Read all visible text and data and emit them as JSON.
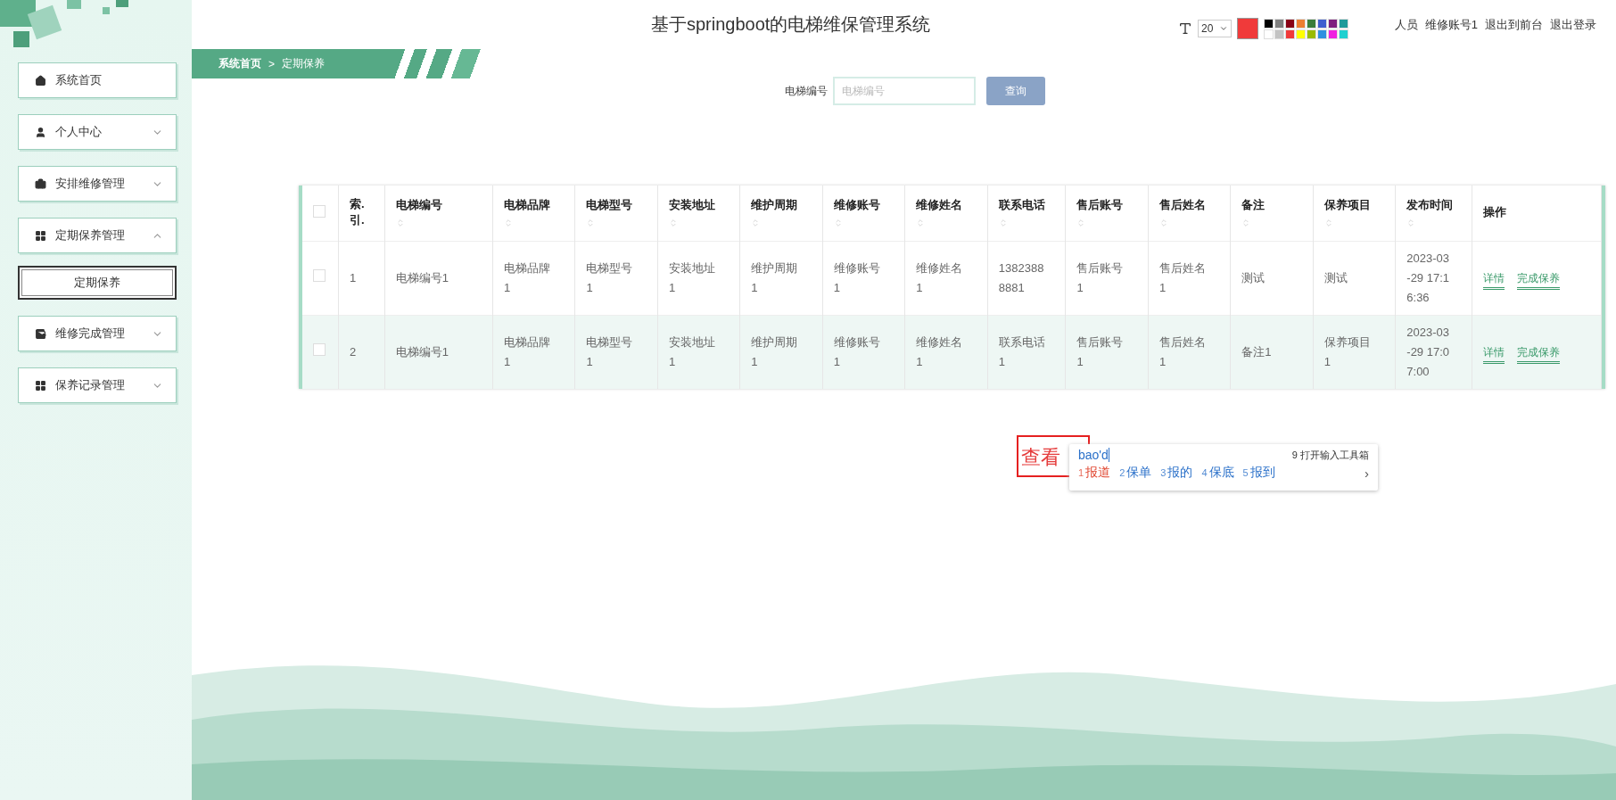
{
  "sidebar": {
    "items": [
      {
        "label": "系统首页",
        "kind": "link"
      },
      {
        "label": "个人中心",
        "kind": "menu",
        "expanded": false
      },
      {
        "label": "安排维修管理",
        "kind": "menu",
        "expanded": false
      },
      {
        "label": "定期保养管理",
        "kind": "menu",
        "expanded": true,
        "children": [
          {
            "label": "定期保养",
            "selected": true
          }
        ]
      },
      {
        "label": "维修完成管理",
        "kind": "menu",
        "expanded": false
      },
      {
        "label": "保养记录管理",
        "kind": "menu",
        "expanded": false
      }
    ]
  },
  "header": {
    "title": "基于springboot的电梯维保管理系统",
    "user_links": [
      "人员",
      "维修账号1",
      "退出到前台",
      "退出登录"
    ]
  },
  "annotation_toolbar": {
    "font_size": "20",
    "current": {
      "color": "#f03a3a"
    },
    "palette": [
      {
        "color": "#000000"
      },
      {
        "color": "#7f7f7f"
      },
      {
        "color": "#880015"
      },
      {
        "color": "#ed7d31"
      },
      {
        "color": "#3b7d3b"
      },
      {
        "color": "#3f5fcf"
      },
      {
        "color": "#7f1f7f"
      },
      {
        "color": "#1f9a9a"
      },
      {
        "color": "#ffffff"
      },
      {
        "color": "#c3c3c3"
      },
      {
        "color": "#f03a3a"
      },
      {
        "color": "#ffff00"
      },
      {
        "color": "#99bb00"
      },
      {
        "color": "#3090e0"
      },
      {
        "color": "#f020e0"
      },
      {
        "color": "#20d0d0"
      }
    ]
  },
  "breadcrumb": [
    "系统首页",
    "定期保养"
  ],
  "breadcrumb_separator": ">",
  "search": {
    "label": "电梯编号",
    "placeholder": "电梯编号",
    "button": "查询"
  },
  "table": {
    "columns": [
      {
        "label": "索.引.",
        "sortable": false
      },
      {
        "label": "电梯编号",
        "sortable": true
      },
      {
        "label": "电梯品牌",
        "sortable": true
      },
      {
        "label": "电梯型号",
        "sortable": true
      },
      {
        "label": "安装地址",
        "sortable": true
      },
      {
        "label": "维护周期",
        "sortable": true
      },
      {
        "label": "维修账号",
        "sortable": true
      },
      {
        "label": "维修姓名",
        "sortable": true
      },
      {
        "label": "联系电话",
        "sortable": true
      },
      {
        "label": "售后账号",
        "sortable": true
      },
      {
        "label": "售后姓名",
        "sortable": true
      },
      {
        "label": "备注",
        "sortable": true
      },
      {
        "label": "保养项目",
        "sortable": true
      },
      {
        "label": "发布时间",
        "sortable": true
      },
      {
        "label": "操作",
        "sortable": false
      }
    ],
    "header_checked": false,
    "rows": [
      {
        "checked": false,
        "highlighted": false,
        "cells": [
          "1",
          "电梯编号1",
          "电梯品牌1",
          "电梯型号1",
          "安装地址1",
          "维护周期1",
          "维修账号1",
          "维修姓名1",
          "13823888881",
          "售后账号1",
          "售后姓名1",
          "测试",
          "测试",
          "2023-03-29 17:16:36"
        ],
        "actions": [
          "详情",
          "完成保养"
        ]
      },
      {
        "checked": false,
        "highlighted": true,
        "cells": [
          "2",
          "电梯编号1",
          "电梯品牌1",
          "电梯型号1",
          "安装地址1",
          "维护周期1",
          "维修账号1",
          "维修姓名1",
          "联系电话1",
          "售后账号1",
          "售后姓名1",
          "备注1",
          "保养项目1",
          "2023-03-29 17:07:00"
        ],
        "actions": [
          "详情",
          "完成保养"
        ]
      }
    ]
  },
  "text_annotation": "查看",
  "ime": {
    "input": "bao'd",
    "hint": "9 打开输入工具箱",
    "candidates": [
      {
        "number": "1",
        "text": "报道",
        "selected": true
      },
      {
        "number": "2",
        "text": "保单",
        "selected": false
      },
      {
        "number": "3",
        "text": "报的",
        "selected": false
      },
      {
        "number": "4",
        "text": "保底",
        "selected": false
      },
      {
        "number": "5",
        "text": "报到",
        "selected": false
      }
    ],
    "next": "›"
  }
}
